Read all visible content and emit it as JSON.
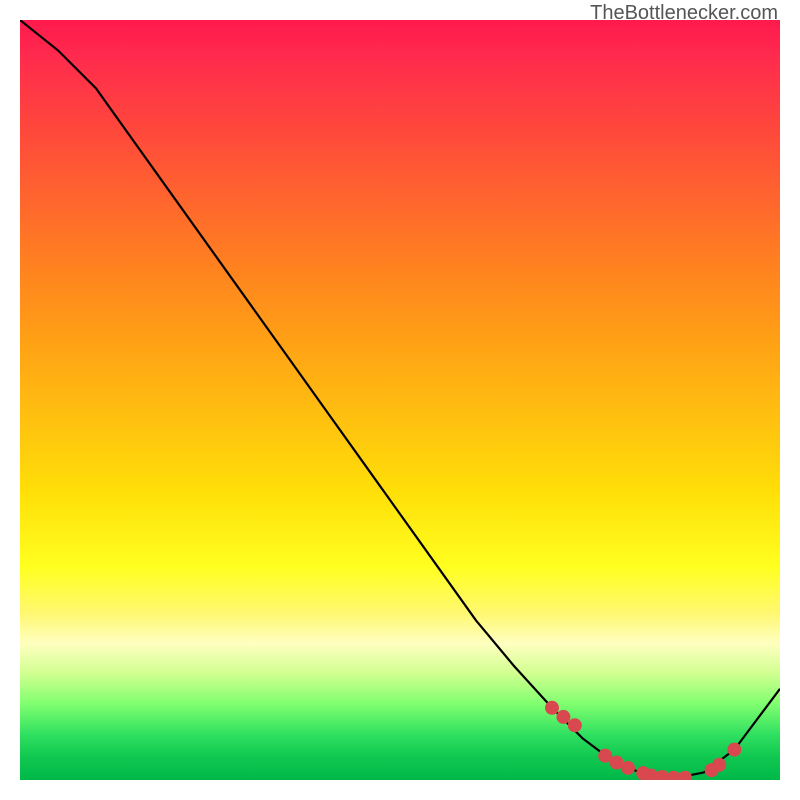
{
  "attribution": "TheBottlenecker.com",
  "chart_data": {
    "type": "line",
    "title": "",
    "xlabel": "",
    "ylabel": "",
    "xlim": [
      0,
      100
    ],
    "ylim": [
      0,
      100
    ],
    "curve": {
      "name": "bottleneck-curve",
      "x": [
        0,
        5,
        10,
        15,
        20,
        25,
        30,
        35,
        40,
        45,
        50,
        55,
        60,
        65,
        70,
        74,
        78,
        82,
        86,
        90,
        94,
        100
      ],
      "y": [
        100,
        96,
        91,
        84,
        77,
        70,
        63,
        56,
        49,
        42,
        35,
        28,
        21,
        15,
        9.5,
        5.5,
        2.5,
        0.8,
        0.2,
        1.0,
        4.0,
        12
      ]
    },
    "points": {
      "name": "salmon-dots",
      "color": "#d9484f",
      "x": [
        70,
        71.5,
        73,
        77,
        78.5,
        80,
        82,
        83,
        84.5,
        86,
        87.5,
        91,
        92,
        94
      ],
      "y": [
        9.5,
        8.3,
        7.2,
        3.2,
        2.3,
        1.6,
        0.9,
        0.6,
        0.4,
        0.3,
        0.3,
        1.3,
        2.0,
        4.0
      ]
    },
    "background_gradient": {
      "stops": [
        {
          "pos": 0,
          "color": "#ff1a4d"
        },
        {
          "pos": 32,
          "color": "#ff8020"
        },
        {
          "pos": 62,
          "color": "#ffdf08"
        },
        {
          "pos": 82,
          "color": "#ffffc0"
        },
        {
          "pos": 100,
          "color": "#00b848"
        }
      ]
    }
  }
}
